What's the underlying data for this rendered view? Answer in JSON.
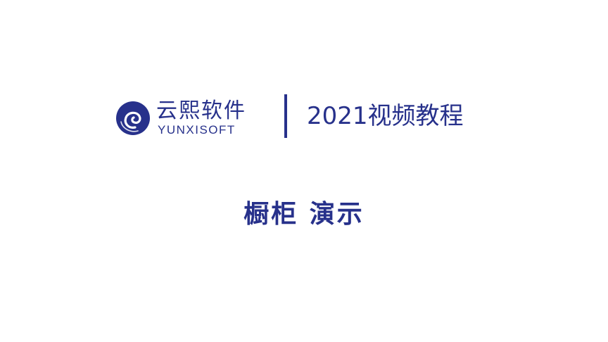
{
  "brand": {
    "name_cn": "云熙软件",
    "name_en": "YUNXISOFT",
    "logo_icon": "spiral-logo-icon",
    "color": "#27318b"
  },
  "series": {
    "title": "2021视频教程"
  },
  "topic": {
    "title": "橱柜 演示"
  }
}
